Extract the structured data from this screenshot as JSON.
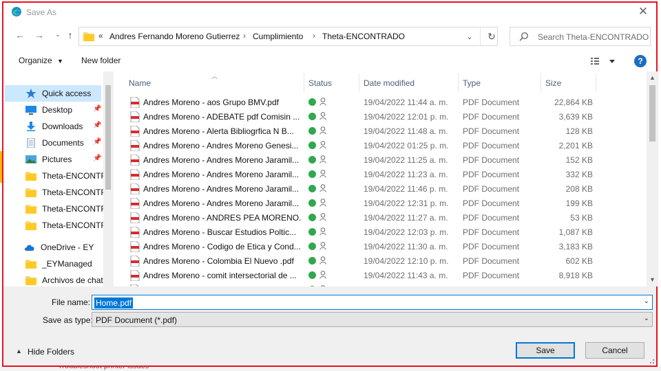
{
  "window": {
    "title": "Save As"
  },
  "address": {
    "overflow": "«",
    "crumbs": [
      "Andres Fernando Moreno Gutierrez",
      "Cumplimiento",
      "Theta-ENCONTRADO"
    ]
  },
  "search": {
    "placeholder": "Search Theta-ENCONTRADO"
  },
  "toolbar": {
    "organize": "Organize",
    "new_folder": "New folder",
    "help": "?"
  },
  "nav": {
    "items": [
      {
        "label": "Quick access",
        "icon": "star-icon",
        "pinned": false
      },
      {
        "label": "Desktop",
        "icon": "desktop-icon",
        "pinned": true
      },
      {
        "label": "Downloads",
        "icon": "download-icon",
        "pinned": true
      },
      {
        "label": "Documents",
        "icon": "documents-icon",
        "pinned": true
      },
      {
        "label": "Pictures",
        "icon": "pictures-icon",
        "pinned": true
      },
      {
        "label": "Theta-ENCONTRADO",
        "icon": "folder-icon",
        "pinned": false
      },
      {
        "label": "Theta-ENCONTRADO",
        "icon": "folder-icon",
        "pinned": false
      },
      {
        "label": "Theta-ENCONTRADO",
        "icon": "folder-icon",
        "pinned": false
      },
      {
        "label": "Theta-ENCONTRADO",
        "icon": "folder-icon",
        "pinned": false
      },
      {
        "label": "OneDrive - EY",
        "icon": "cloud-icon",
        "pinned": false
      },
      {
        "label": "_EYManaged",
        "icon": "folder-icon",
        "pinned": false
      },
      {
        "label": "Archivos de chat",
        "icon": "folder-icon",
        "pinned": false
      }
    ]
  },
  "columns": {
    "name": "Name",
    "status": "Status",
    "date": "Date modified",
    "type": "Type",
    "size": "Size"
  },
  "files": [
    {
      "name": "Andres Moreno -  aos  Grupo BMV.pdf",
      "date": "19/04/2022 11:44 a. m.",
      "type": "PDF Document",
      "size": "22,864 KB"
    },
    {
      "name": "Andres Moreno - ADEBATE pdf  Comisin ...",
      "date": "19/04/2022 12:01 p. m.",
      "type": "PDF Document",
      "size": "3,639 KB"
    },
    {
      "name": "Andres Moreno - Alerta Bibliogrfica N   B...",
      "date": "19/04/2022 11:48 a. m.",
      "type": "PDF Document",
      "size": "128 KB"
    },
    {
      "name": "Andres Moreno - Andres Moreno  Genesi...",
      "date": "19/04/2022 01:25 p. m.",
      "type": "PDF Document",
      "size": "2,201 KB"
    },
    {
      "name": "Andres Moreno - Andres Moreno Jaramil...",
      "date": "19/04/2022 11:25 a. m.",
      "type": "PDF Document",
      "size": "152 KB"
    },
    {
      "name": "Andres Moreno - Andres Moreno Jaramil...",
      "date": "19/04/2022 11:23 a. m.",
      "type": "PDF Document",
      "size": "332 KB"
    },
    {
      "name": "Andres Moreno - Andres Moreno Jaramil...",
      "date": "19/04/2022 11:46 p. m.",
      "type": "PDF Document",
      "size": "208 KB"
    },
    {
      "name": "Andres Moreno - Andres Moreno Jaramil...",
      "date": "19/04/2022 12:31 p. m.",
      "type": "PDF Document",
      "size": "199 KB"
    },
    {
      "name": "Andres Moreno - ANDRES PEA MORENO...",
      "date": "19/04/2022 11:27 a. m.",
      "type": "PDF Document",
      "size": "53 KB"
    },
    {
      "name": "Andres Moreno - Buscar  Estudios Poltic...",
      "date": "19/04/2022 12:03 p. m.",
      "type": "PDF Document",
      "size": "1,087 KB"
    },
    {
      "name": "Andres Moreno - Codigo de Etica y Cond...",
      "date": "19/04/2022 11:30 a. m.",
      "type": "PDF Document",
      "size": "3,183 KB"
    },
    {
      "name": "Andres Moreno - Colombia  El Nuevo .pdf",
      "date": "19/04/2022 12:10 p. m.",
      "type": "PDF Document",
      "size": "602 KB"
    },
    {
      "name": "Andres Moreno - comit intersectorial de ...",
      "date": "19/04/2022 11:43 a. m.",
      "type": "PDF Document",
      "size": "8,918 KB"
    }
  ],
  "form": {
    "file_name_label": "File name:",
    "file_name_value": "Home.pdf",
    "save_type_label": "Save as type:",
    "save_type_value": "PDF Document (*.pdf)"
  },
  "footer": {
    "hide_folders": "Hide Folders",
    "save": "Save",
    "cancel": "Cancel"
  },
  "background": {
    "bottom_text": "Troubleshoot printer issues"
  },
  "colors": {
    "accent": "#0078d7",
    "highlight_border": "#e81123",
    "status_ok": "#2fa84f"
  }
}
